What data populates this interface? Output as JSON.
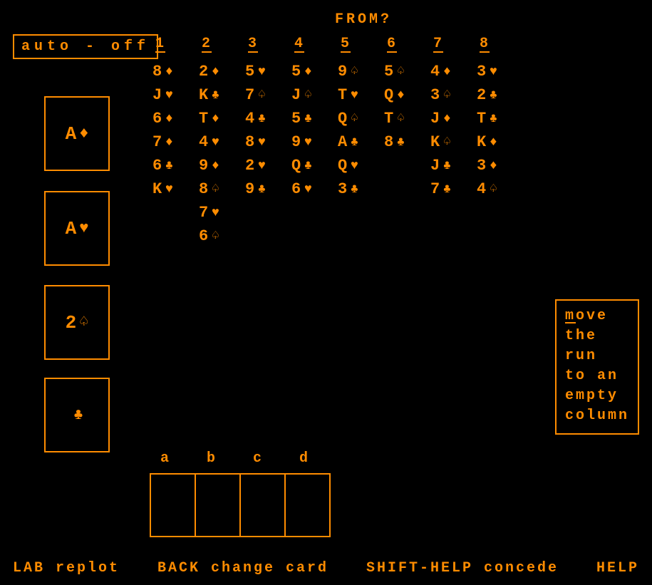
{
  "prompt": "FROM?",
  "auto_toggle": "auto - off",
  "column_labels": [
    "1",
    "2",
    "3",
    "4",
    "5",
    "6",
    "7",
    "8"
  ],
  "columns": [
    [
      {
        "r": "8",
        "s": "diamond"
      },
      {
        "r": "J",
        "s": "heart"
      },
      {
        "r": "6",
        "s": "diamond"
      },
      {
        "r": "7",
        "s": "diamond"
      },
      {
        "r": "6",
        "s": "club"
      },
      {
        "r": "K",
        "s": "heart"
      }
    ],
    [
      {
        "r": "2",
        "s": "diamond"
      },
      {
        "r": "K",
        "s": "club"
      },
      {
        "r": "T",
        "s": "diamond"
      },
      {
        "r": "4",
        "s": "heart"
      },
      {
        "r": "9",
        "s": "diamond"
      },
      {
        "r": "8",
        "s": "spade"
      },
      {
        "r": "7",
        "s": "heart"
      },
      {
        "r": "6",
        "s": "spade"
      }
    ],
    [
      {
        "r": "5",
        "s": "heart"
      },
      {
        "r": "7",
        "s": "spade"
      },
      {
        "r": "4",
        "s": "club"
      },
      {
        "r": "8",
        "s": "heart"
      },
      {
        "r": "2",
        "s": "heart"
      },
      {
        "r": "9",
        "s": "club"
      }
    ],
    [
      {
        "r": "5",
        "s": "diamond"
      },
      {
        "r": "J",
        "s": "spade"
      },
      {
        "r": "5",
        "s": "club"
      },
      {
        "r": "9",
        "s": "heart"
      },
      {
        "r": "Q",
        "s": "club"
      },
      {
        "r": "6",
        "s": "heart"
      }
    ],
    [
      {
        "r": "9",
        "s": "spade"
      },
      {
        "r": "T",
        "s": "heart"
      },
      {
        "r": "Q",
        "s": "spade"
      },
      {
        "r": "A",
        "s": "club"
      },
      {
        "r": "Q",
        "s": "heart"
      },
      {
        "r": "3",
        "s": "club"
      }
    ],
    [
      {
        "r": "5",
        "s": "spade"
      },
      {
        "r": "Q",
        "s": "diamond"
      },
      {
        "r": "T",
        "s": "spade"
      },
      {
        "r": "8",
        "s": "club"
      }
    ],
    [
      {
        "r": "4",
        "s": "diamond"
      },
      {
        "r": "3",
        "s": "spade"
      },
      {
        "r": "J",
        "s": "diamond"
      },
      {
        "r": "K",
        "s": "spade"
      },
      {
        "r": "J",
        "s": "club"
      },
      {
        "r": "7",
        "s": "club"
      }
    ],
    [
      {
        "r": "3",
        "s": "heart"
      },
      {
        "r": "2",
        "s": "club"
      },
      {
        "r": "T",
        "s": "club"
      },
      {
        "r": "K",
        "s": "diamond"
      },
      {
        "r": "3",
        "s": "diamond"
      },
      {
        "r": "4",
        "s": "spade"
      }
    ]
  ],
  "foundations": [
    {
      "r": "A",
      "s": "diamond"
    },
    {
      "r": "A",
      "s": "heart"
    },
    {
      "r": "2",
      "s": "spade"
    },
    {
      "r": "",
      "s": "club"
    }
  ],
  "freecell_labels": [
    "a",
    "b",
    "c",
    "d"
  ],
  "freecells": [
    null,
    null,
    null,
    null
  ],
  "help_lines": [
    "move",
    "the",
    "run",
    "to an",
    "empty",
    "column"
  ],
  "bottom": {
    "replot": "LAB replot",
    "back": "BACK change card",
    "concede": "SHIFT-HELP concede",
    "help": "HELP"
  }
}
